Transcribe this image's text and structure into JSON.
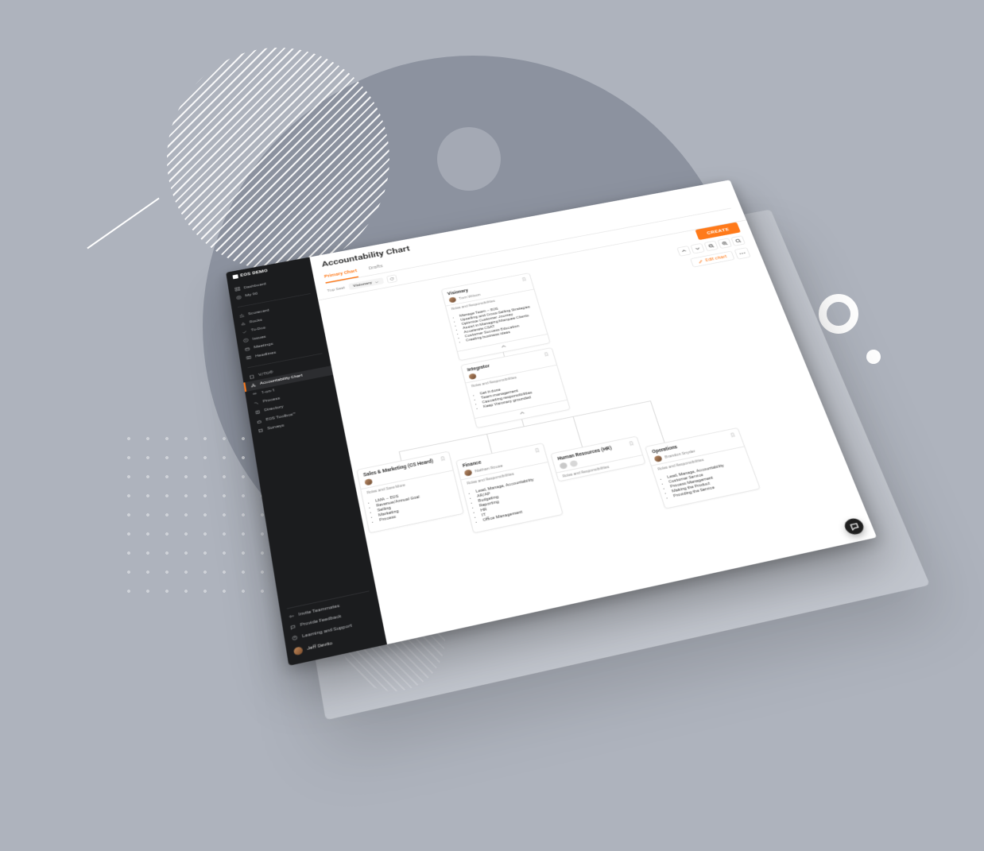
{
  "brand": "EOS DEMO",
  "sidebar": {
    "primary": [
      {
        "label": "Dashboard"
      },
      {
        "label": "My 90"
      }
    ],
    "secondary": [
      {
        "label": "Scorecard"
      },
      {
        "label": "Rocks"
      },
      {
        "label": "To-Dos"
      },
      {
        "label": "Issues"
      },
      {
        "label": "Meetings"
      },
      {
        "label": "Headlines"
      }
    ],
    "tertiary": [
      {
        "label": "V/TO®"
      },
      {
        "label": "Accountability Chart",
        "active": true
      },
      {
        "label": "1-on-1"
      },
      {
        "label": "Process"
      },
      {
        "label": "Directory"
      },
      {
        "label": "EOS Toolbox™"
      },
      {
        "label": "Surveys"
      }
    ],
    "footer": [
      {
        "label": "Invite Teammates"
      },
      {
        "label": "Provide Feedback"
      },
      {
        "label": "Learning and Support"
      }
    ],
    "user": "Jeff Devito"
  },
  "header": {
    "title": "Accountability Chart",
    "tabs": [
      {
        "label": "Primary Chart",
        "active": true
      },
      {
        "label": "Drafts"
      }
    ],
    "filter_label": "Top Seat",
    "filter_value": "Visionary"
  },
  "actions": {
    "create": "CREATE",
    "edit": "Edit chart"
  },
  "org": {
    "roles_label": "Roles and Responsibilities",
    "visionary": {
      "title": "Visionary",
      "person": "Tom Wilson",
      "responsibilities": [
        "Manage Team – EOS",
        "Upselling and Cross-Selling Strategies",
        "Optimize Customer Journey",
        "Assist in Managing Marquee Clients",
        "Accelerate CSAT",
        "Customer Success Education",
        "Creating business ideas"
      ]
    },
    "integrator": {
      "title": "Integrator",
      "person": "",
      "responsibilities": [
        "Get it done",
        "Team management",
        "Cascading responsibilities",
        "Keep Visionary grounded"
      ]
    },
    "sales": {
      "title": "Sales & Marketing (CS Heard)",
      "person": "",
      "sub_label": "Roles and Save More",
      "responsibilities": [
        "LMA – EOS",
        "Revenue/Annual Goal",
        "Selling",
        "Marketing",
        "Process"
      ]
    },
    "finance": {
      "title": "Finance",
      "person": "Nathan Rouse",
      "responsibilities": [
        "Lead, Manage, Accountability",
        "AR/AP",
        "Budgeting",
        "Reporting",
        "HR",
        "IT",
        "Office Management"
      ]
    },
    "hr": {
      "title": "Human Resources (HR)",
      "person": ""
    },
    "operations": {
      "title": "Operations",
      "person": "Brandon Snyder",
      "responsibilities": [
        "Lead, Manage, Accountability",
        "Customer Service",
        "Process Management",
        "Making the Product",
        "Providing the Service"
      ]
    }
  }
}
